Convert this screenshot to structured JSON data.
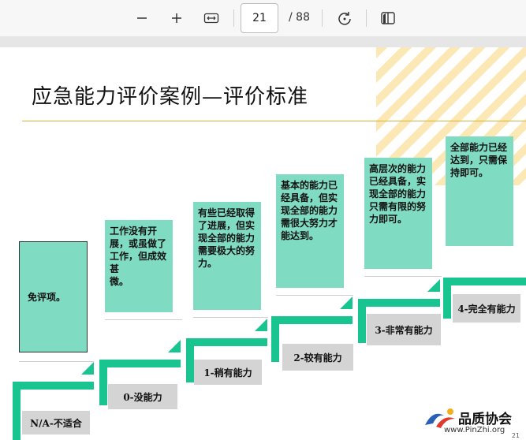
{
  "toolbar": {
    "zoom_out_icon": "minus-icon",
    "zoom_in_icon": "plus-icon",
    "fit_icon": "fit-width-icon",
    "current_page": "21",
    "total_pages": "/ 88",
    "rotate_icon": "rotate-icon",
    "two_page_icon": "page-view-icon"
  },
  "slide": {
    "title": "应急能力评价案例—评价标准",
    "levels": [
      {
        "label": "N/A-不适合",
        "desc": [
          "免评项。"
        ]
      },
      {
        "label": "0-没能力",
        "desc": [
          "工作没有开展，或虽做了工作，但成效甚",
          "微。"
        ]
      },
      {
        "label": "1-稍有能力",
        "desc": [
          "有些已经取得了进展，但实现全部的能力",
          "需要极大的努力。"
        ]
      },
      {
        "label": "2-较有能力",
        "desc": [
          "基本的能力已经具备，但实现全部的能力",
          "需很大努力才能达到。"
        ]
      },
      {
        "label": "3-非常有能力",
        "desc": [
          "高层次的能力已经具备，实现全部的能力",
          "只需有限的努力即可。"
        ]
      },
      {
        "label": "4-完全有能力",
        "desc": [
          "全部能力已经达到，只需保持即可。"
        ]
      }
    ],
    "logo_text": "品质协会",
    "logo_url": "www.PinZhi.org",
    "page_number": "21"
  },
  "colors": {
    "teal": "#18c48f",
    "desc_bg": "#7fdcc2",
    "label_bg": "#d4d4d4",
    "accent_line": "#d8b43c"
  }
}
